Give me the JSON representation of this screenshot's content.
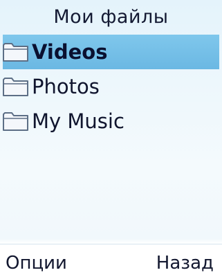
{
  "header": {
    "title": "Мои файлы"
  },
  "files": [
    {
      "label": "Videos",
      "icon": "folder-icon",
      "selected": true
    },
    {
      "label": "Photos",
      "icon": "folder-icon",
      "selected": false
    },
    {
      "label": "My Music",
      "icon": "folder-icon",
      "selected": false
    }
  ],
  "softkeys": {
    "left_label": "Опции",
    "right_label": "Назад"
  },
  "colors": {
    "background": "#edf7fc",
    "selection": "#75c0e8",
    "folder_outline": "#5d6f86",
    "folder_fill": "#f4f7fb",
    "text": "#10152e"
  }
}
